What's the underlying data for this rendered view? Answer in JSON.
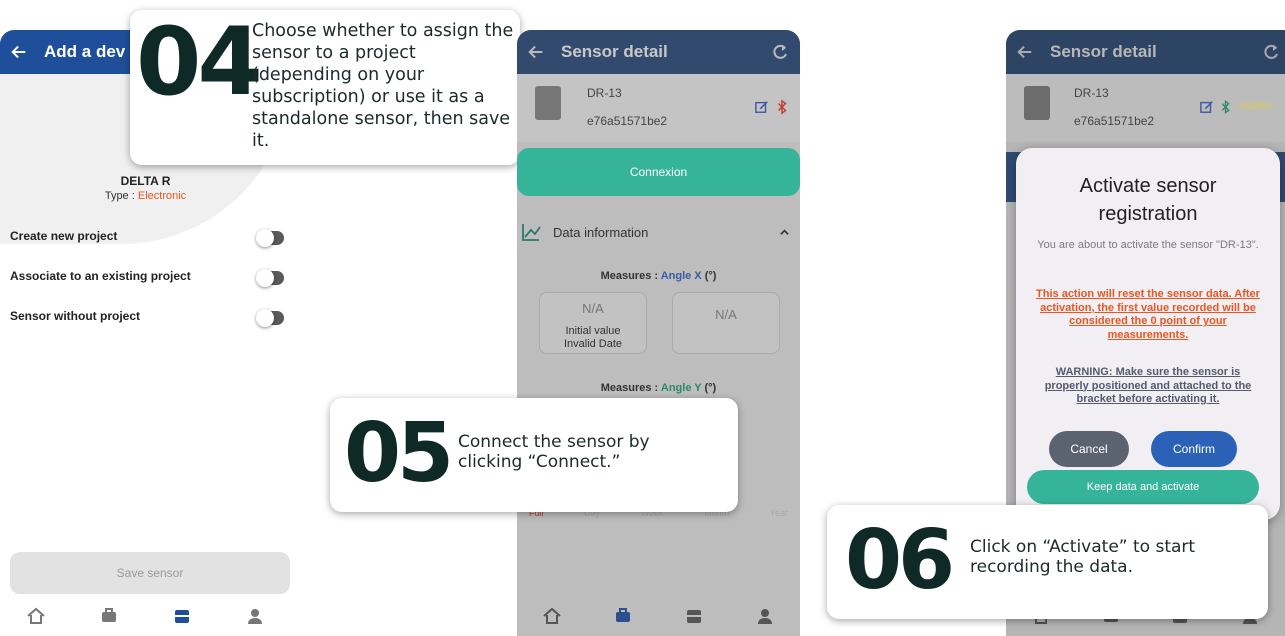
{
  "colors": {
    "appbar": "#1f4f9a",
    "teal": "#35b49a",
    "accent_orange": "#e8571f",
    "dark_text": "#0f2a26"
  },
  "screen1": {
    "header_title": "Add a dev",
    "device_name": "DELTA R",
    "type_label": "Type : ",
    "type_value": "Electronic",
    "options": [
      {
        "label": "Create new project"
      },
      {
        "label": "Associate to an existing project"
      },
      {
        "label": "Sensor without project"
      }
    ],
    "save_button": "Save sensor",
    "nav": [
      "home-icon",
      "briefcase-icon",
      "sensor-icon",
      "user-icon"
    ]
  },
  "callout4": {
    "number": "04",
    "text": "Choose whether to assign the sensor to a project (depending on your subscription) or use it as a standalone sensor, then save it."
  },
  "screen2": {
    "header_title": "Sensor detail",
    "sensor_name": "DR-13",
    "sensor_id": "e76a51571be2",
    "connect_button": "Connexion",
    "section_title": "Data information",
    "measures_label": "Measures : ",
    "measure_x": "Angle X",
    "measure_x_unit": "(°)",
    "card1_value": "N/A",
    "card1_caption1": "Initial value",
    "card1_caption2": "Invalid Date",
    "card2_value": "N/A",
    "measure_y": "Angle Y",
    "measure_y_unit": "(°)",
    "filters": [
      "Full",
      "Day",
      "Week",
      "Month",
      "Year"
    ]
  },
  "callout5": {
    "number": "05",
    "text": "Connect the sensor by clicking “Connect.”"
  },
  "screen3": {
    "header_title": "Sensor detail",
    "sensor_name": "DR-13",
    "sensor_id": "e76a51571be2",
    "signal": "-58dBm",
    "dialog_title": "Activate sensor registration",
    "dialog_info": "You are about to activate the sensor \"DR-13\".",
    "dialog_warning1": "This action will reset the sensor data. After activation, the first value recorded will be considered the 0 point of your measurements.",
    "dialog_warning2": "WARNING: Make sure the sensor is properly positioned and attached to the bracket before activating it.",
    "cancel_button": "Cancel",
    "confirm_button": "Confirm",
    "keep_button": "Keep data and activate"
  },
  "callout6": {
    "number": "06",
    "text": "Click on “Activate” to start recording the data."
  }
}
